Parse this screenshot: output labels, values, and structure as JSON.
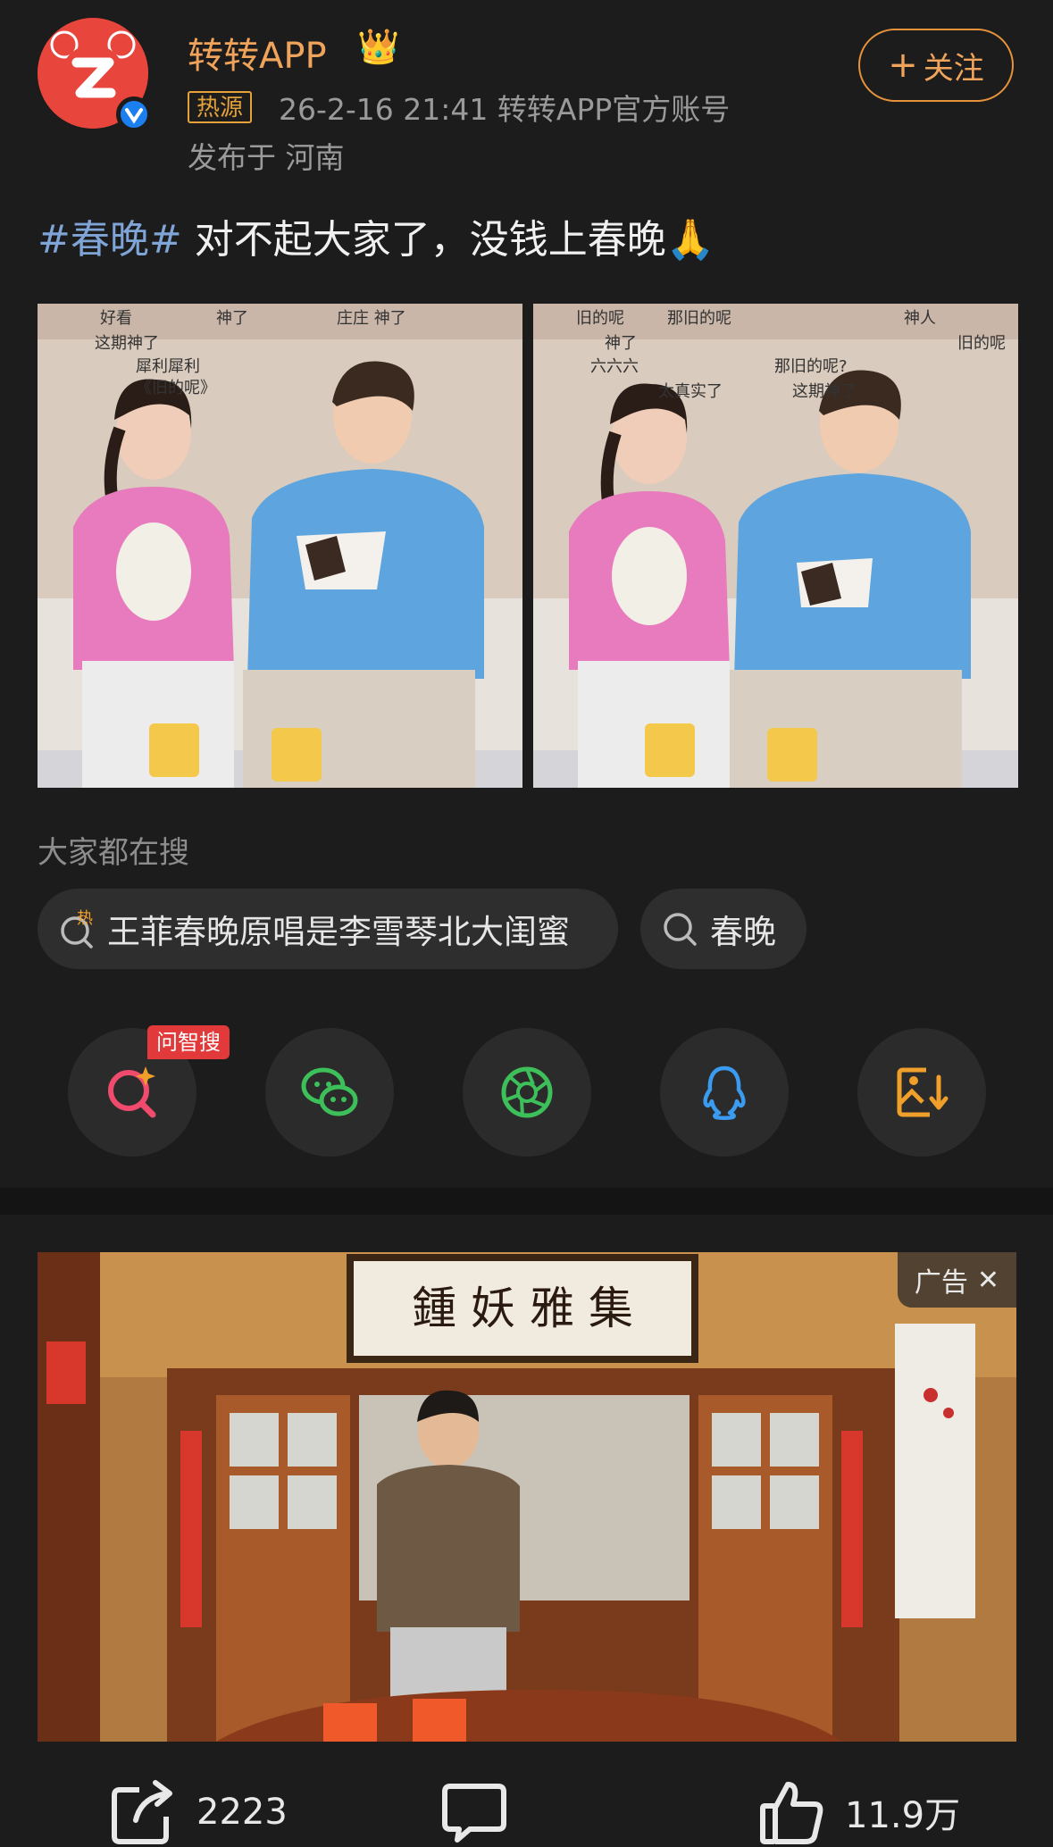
{
  "post": {
    "username": "转转APP",
    "crown_icon": "crown-icon",
    "hot_tag": "热源",
    "meta": "26-2-16 21:41  转转APP官方账号",
    "location": "发布于 河南",
    "follow_label": "关注",
    "hashtag": "#春晚#",
    "text": " 对不起大家了，没钱上春晚",
    "emoji": "🙏"
  },
  "images": {
    "img1_captions": [
      "好看",
      "神了",
      "庄庄 神了",
      "这期神了",
      "犀利犀利",
      "《旧的呢》"
    ],
    "img2_captions": [
      "旧的呢",
      "那旧的呢",
      "神人",
      "神了",
      "六六六",
      "太真实了",
      "那旧的呢?",
      "这期神了",
      "旧的呢"
    ]
  },
  "search": {
    "title": "大家都在搜",
    "chip1": "王菲春晚原唱是李雪琴北大闺蜜",
    "chip2": "春晚"
  },
  "share": {
    "ai_badge": "问智搜"
  },
  "ad": {
    "tag": "广告",
    "close": "✕",
    "plaque": "鍾 妖 雅 集"
  },
  "actions": {
    "share_count": "2223",
    "like_count": "11.9万"
  },
  "colors": {
    "background": "#1c1c1c",
    "username": "#f0a35a",
    "hashtag": "#7fa4d6",
    "ai_badge": "#e23a3a",
    "wechat_green": "#3dbf5a",
    "qq_blue": "#3a9bf0",
    "save_orange": "#f0a02a"
  }
}
